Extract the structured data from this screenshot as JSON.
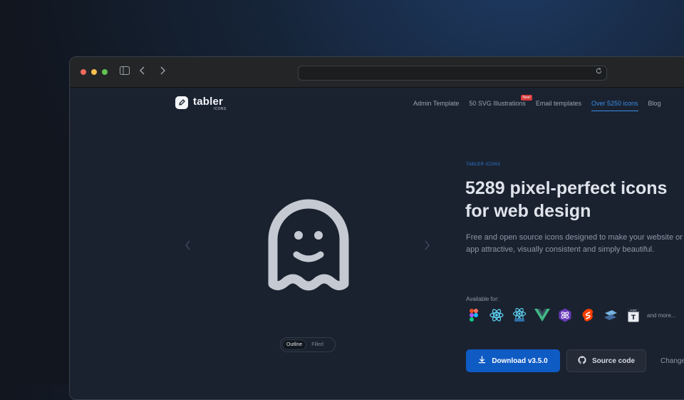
{
  "browser": {
    "address": "",
    "icons": {
      "sidebar": "sidebar-icon",
      "back": "chevron-left-icon",
      "forward": "chevron-right-icon",
      "reload": "reload-icon"
    }
  },
  "logo": {
    "name": "tabler",
    "sub": "ICONS"
  },
  "nav": {
    "items": [
      "Admin Template",
      "50 SVG Illustrations",
      "Email templates",
      "Over 5250 icons",
      "Blog"
    ],
    "badge": "New!"
  },
  "hero": {
    "eyebrow": "TABLER ICONS",
    "headline_line1": "5289 pixel-perfect icons",
    "headline_line2": "for web design",
    "description": "Free and open source icons designed to make your website or app attractive, visually consistent and simply beautiful.",
    "available_label": "Available for:",
    "frameworks": [
      "figma-icon",
      "react-icon",
      "react-native-icon",
      "vue-icon",
      "preact-icon",
      "svelte-icon",
      "solidjs-icon",
      "font-icon"
    ],
    "more_label": "and more...",
    "download_label": "Download v3.5.0",
    "source_label": "Source code",
    "changelog_label": "Change"
  },
  "preview": {
    "icon": "ghost-icon",
    "toggle_outline": "Outline",
    "toggle_filled": "Filled"
  },
  "colors": {
    "accent": "#0f5bc4",
    "link_active": "#3a8de5",
    "badge": "#d63939",
    "page_bg": "#1a2230"
  }
}
